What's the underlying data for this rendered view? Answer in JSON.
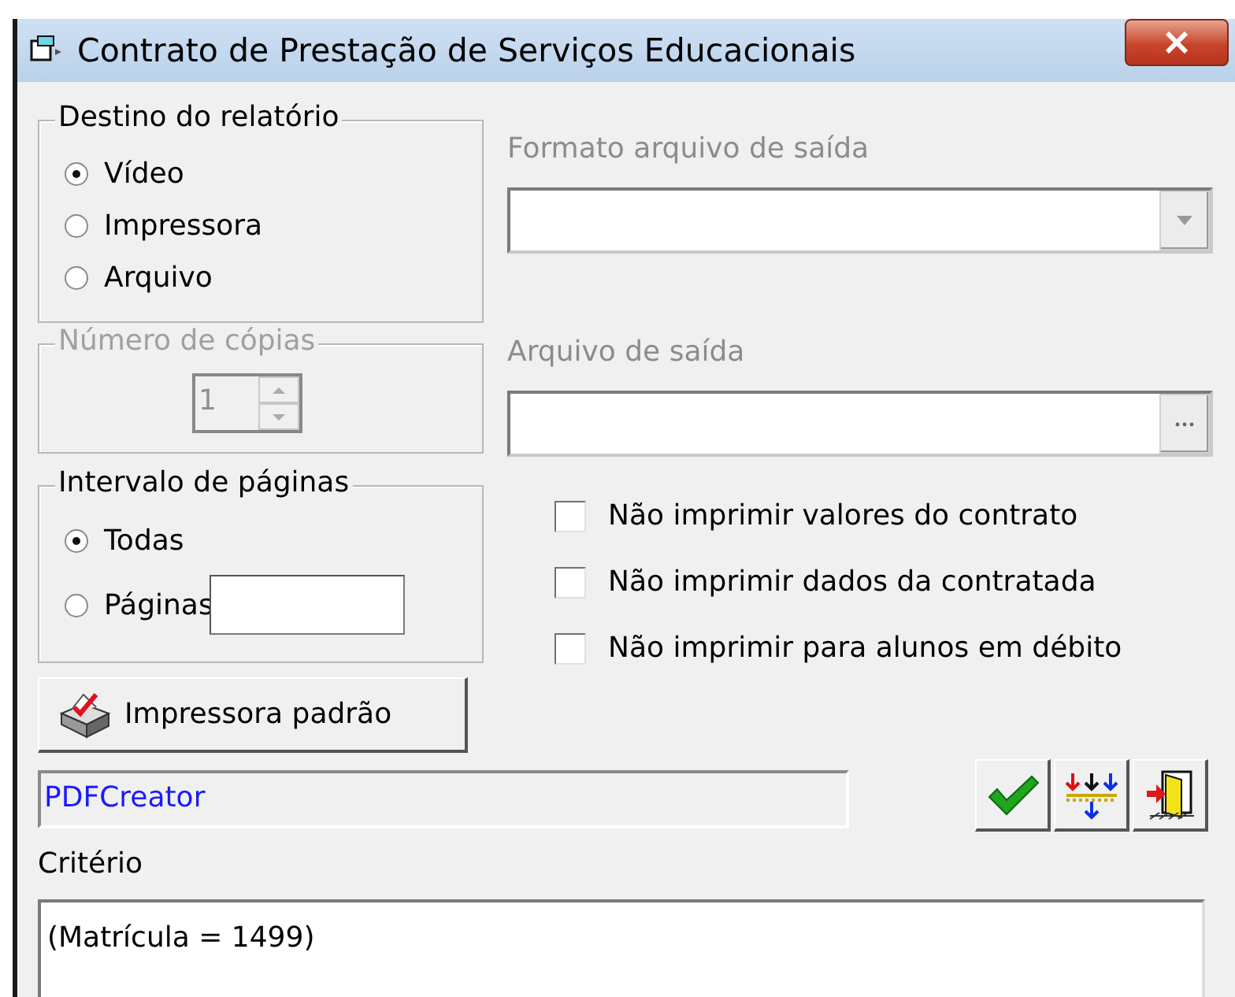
{
  "window": {
    "title": "Contrato de Prestação de Serviços Educacionais"
  },
  "destination": {
    "title": "Destino do relatório",
    "options": [
      {
        "label": "Vídeo",
        "selected": true
      },
      {
        "label": "Impressora",
        "selected": false
      },
      {
        "label": "Arquivo",
        "selected": false
      }
    ]
  },
  "copies": {
    "title": "Número de cópias",
    "value": "1",
    "disabled": true
  },
  "output_format": {
    "label": "Formato arquivo de saída",
    "disabled": true
  },
  "output_file": {
    "label": "Arquivo de saída",
    "disabled": true
  },
  "page_range": {
    "title": "Intervalo de páginas",
    "options": [
      {
        "label": "Todas",
        "selected": true,
        "has_field": false
      },
      {
        "label": "Páginas",
        "selected": false,
        "has_field": true
      }
    ]
  },
  "options": [
    {
      "label": "Não imprimir valores do contrato",
      "checked": false
    },
    {
      "label": "Não imprimir dados da contratada",
      "checked": false
    },
    {
      "label": "Não imprimir para alunos em débito",
      "checked": false
    }
  ],
  "printer_button": {
    "label": "Impressora padrão"
  },
  "printer_name": {
    "value": "PDFCreator"
  },
  "toolbar": [
    {
      "kind": "confirm"
    },
    {
      "kind": "sort"
    },
    {
      "kind": "exit"
    }
  ],
  "criteria": {
    "label": "Critério",
    "value": "(Matrícula = 1499)"
  }
}
